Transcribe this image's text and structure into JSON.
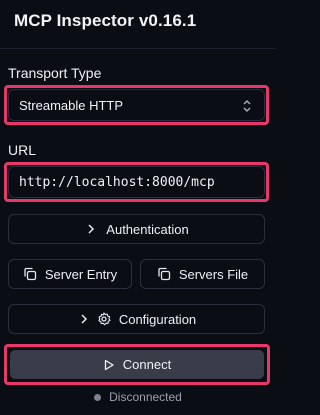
{
  "app": {
    "title": "MCP Inspector v0.16.1"
  },
  "transport": {
    "label": "Transport Type",
    "selected": "Streamable HTTP"
  },
  "url": {
    "label": "URL",
    "value": "http://localhost:8000/mcp"
  },
  "buttons": {
    "authentication": "Authentication",
    "server_entry": "Server Entry",
    "servers_file": "Servers File",
    "configuration": "Configuration",
    "connect": "Connect"
  },
  "status": {
    "text": "Disconnected"
  },
  "colors": {
    "highlight": "#e8386b",
    "background": "#0b0d14",
    "connect_bg": "#3a3d49"
  }
}
